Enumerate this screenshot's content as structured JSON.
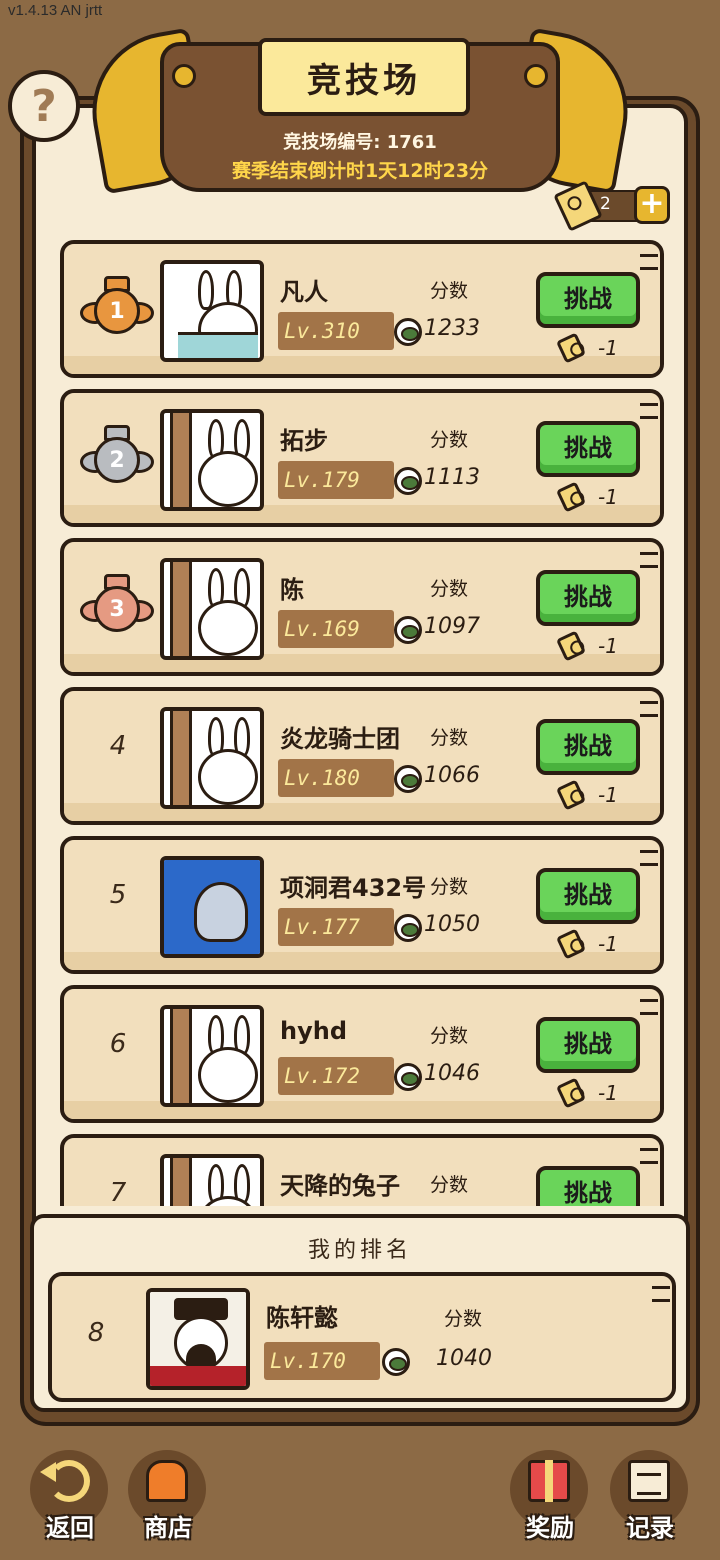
{
  "version": "v1.4.13 AN jrtt",
  "header": {
    "title": "竞技场",
    "arena_no_label": "竞技场编号:",
    "arena_no": "1761",
    "countdown": "赛季结束倒计时1天12时23分"
  },
  "help": {
    "label": "?"
  },
  "tickets": {
    "count": "2",
    "plus": "+"
  },
  "labels": {
    "score": "分数",
    "challenge": "挑战",
    "cost": "-1"
  },
  "ranking": [
    {
      "rank": "1",
      "name": "凡人",
      "level": "Lv.310",
      "score": "1233",
      "medal": "gold"
    },
    {
      "rank": "2",
      "name": "拓步",
      "level": "Lv.179",
      "score": "1113",
      "medal": "silver"
    },
    {
      "rank": "3",
      "name": "陈",
      "level": "Lv.169",
      "score": "1097",
      "medal": "bronze"
    },
    {
      "rank": "4",
      "name": "炎龙骑士团",
      "level": "Lv.180",
      "score": "1066"
    },
    {
      "rank": "5",
      "name": "项洞君432号",
      "level": "Lv.177",
      "score": "1050"
    },
    {
      "rank": "6",
      "name": "hyhd",
      "level": "Lv.172",
      "score": "1046"
    },
    {
      "rank": "7",
      "name": "天降的兔子",
      "level": "",
      "score": ""
    }
  ],
  "my_rank": {
    "title": "我的排名",
    "rank": "8",
    "name": "陈轩懿",
    "level": "Lv.170",
    "score": "1040"
  },
  "nav": {
    "back": "返回",
    "shop": "商店",
    "reward": "奖励",
    "record": "记录"
  },
  "colors": {
    "frame": "#6b4a2b",
    "panel": "#f7ecd6",
    "row": "#f2dfbd",
    "challenge_green": "#6ad45a",
    "gold": "#e7b62f"
  }
}
